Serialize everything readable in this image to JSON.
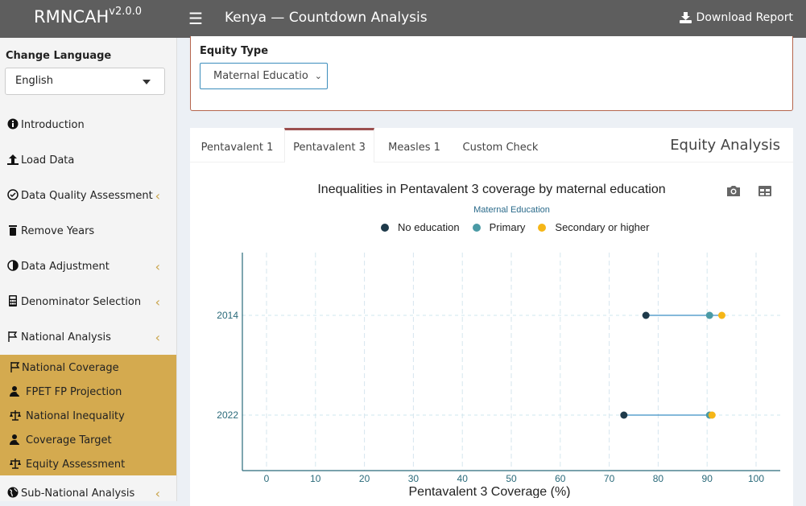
{
  "app": {
    "name": "RMNCAH",
    "version": "v2.0.0",
    "title": "Kenya — Countdown Analysis",
    "download_label": "Download Report"
  },
  "sidebar": {
    "language_label": "Change Language",
    "language_value": "English",
    "items": [
      {
        "label": "Introduction",
        "icon": "info-icon",
        "has_sub": false
      },
      {
        "label": "Load Data",
        "icon": "upload-icon",
        "has_sub": false
      },
      {
        "label": "Data Quality Assessment",
        "icon": "check-circle-icon",
        "has_sub": true
      },
      {
        "label": "Remove Years",
        "icon": "trash-icon",
        "has_sub": false
      },
      {
        "label": "Data Adjustment",
        "icon": "half-circle-icon",
        "has_sub": true
      },
      {
        "label": "Denominator Selection",
        "icon": "calculator-icon",
        "has_sub": true
      },
      {
        "label": "National Analysis",
        "icon": "flag-icon",
        "has_sub": true
      }
    ],
    "subitems": [
      {
        "label": "National Coverage",
        "icon": "flag-icon"
      },
      {
        "label": "FPET FP Projection",
        "icon": "person-icon"
      },
      {
        "label": "National Inequality",
        "icon": "scale-icon"
      },
      {
        "label": "Coverage Target",
        "icon": "person-icon"
      },
      {
        "label": "Equity Assessment",
        "icon": "scale-icon"
      }
    ],
    "after_item": {
      "label": "Sub-National Analysis",
      "icon": "globe-icon"
    },
    "accent_color": "#d4aa4f"
  },
  "equity": {
    "label": "Equity Type",
    "selected": "Maternal Education"
  },
  "tabs": {
    "items": [
      "Pentavalent 1",
      "Pentavalent 3",
      "Measles 1",
      "Custom Check"
    ],
    "active": "Pentavalent 3",
    "box_title": "Equity Analysis"
  },
  "chart": {
    "title": "Inequalities in Pentavalent 3 coverage by maternal education",
    "legend_title": "Maternal Education"
  },
  "chart_data": {
    "type": "scatter",
    "title": "Inequalities in Pentavalent 3 coverage by maternal education",
    "xlabel": "Pentavalent 3 Coverage (%)",
    "ylabel": "",
    "xlim": [
      0,
      100
    ],
    "x_ticks": [
      0,
      10,
      20,
      30,
      40,
      50,
      60,
      70,
      80,
      90,
      100
    ],
    "categories": [
      "2014",
      "2022"
    ],
    "legend_title": "Maternal Education",
    "legend_position": "top",
    "grid": true,
    "series": [
      {
        "name": "No education",
        "color": "#1e3a4a",
        "values": [
          77.5,
          73.0
        ]
      },
      {
        "name": "Primary",
        "color": "#4a9aa5",
        "values": [
          90.5,
          90.5
        ]
      },
      {
        "name": "Secondary or higher",
        "color": "#f5b617",
        "values": [
          93.0,
          91.0
        ]
      }
    ]
  }
}
